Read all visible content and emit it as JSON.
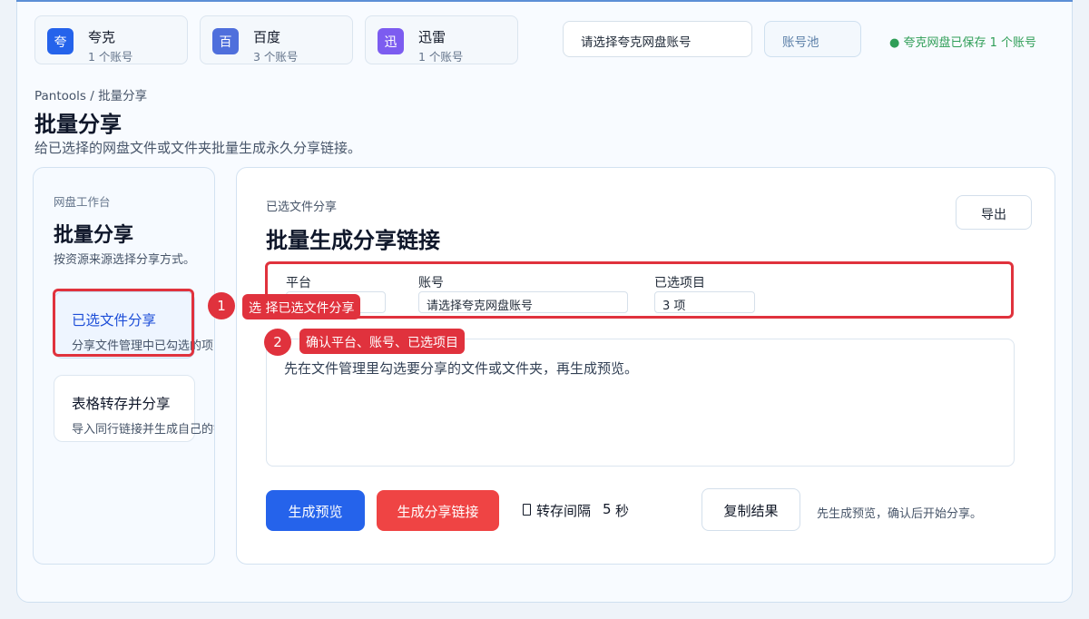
{
  "platforms": [
    {
      "name": "夸克",
      "icon": "夸",
      "count": "1 个账号",
      "color": "#2563eb"
    },
    {
      "name": "百度",
      "icon": "百",
      "count": "3 个账号",
      "color": "#4f6fdc"
    },
    {
      "name": "迅雷",
      "icon": "迅",
      "count": "1 个账号",
      "color": "#7c5cf0"
    }
  ],
  "account_select": "请选择夸克网盘账号",
  "pool_button": "账号池",
  "saved_status": "● 夸克网盘已保存 1 个账号",
  "breadcrumb": "Pantools / 批量分享",
  "page": {
    "title": "批量分享",
    "description": "给已选择的网盘文件或文件夹批量生成永久分享链接。"
  },
  "sidebar": {
    "eyebrow": "网盘工作台",
    "title": "批量分享",
    "description": "按资源来源选择分享方式。",
    "modes": [
      {
        "title": "已选文件分享",
        "desc": "分享文件管理中已勾选的项目"
      },
      {
        "title": "表格转存并分享",
        "desc": "导入同行链接并生成自己的链接"
      }
    ]
  },
  "main": {
    "eyebrow": "已选文件分享",
    "title": "批量生成分享链接",
    "export_label": "导出",
    "fields": {
      "platform_label": "平台",
      "platform_value": "",
      "account_label": "账号",
      "account_value": "请选择夸克网盘账号",
      "selected_label": "已选项目",
      "selected_value": "3 项"
    },
    "result_placeholder": "先在文件管理里勾选要分享的文件或文件夹，再生成预览。",
    "preview_button": "生成预览",
    "share_button": "生成分享链接",
    "interval_label": "转存间隔",
    "interval_value": "5",
    "interval_unit": "秒",
    "copy_button": "复制结果",
    "hint": "先生成预览，确认后开始分享。"
  },
  "annotations": [
    {
      "number": "1",
      "text": "选 择已选文件分享"
    },
    {
      "number": "2",
      "text": "确认平台、账号、已选项目"
    }
  ],
  "colors": {
    "primary": "#2563eb",
    "danger": "#ef4444",
    "annotation": "#e0323d",
    "success": "#2f9e57"
  }
}
